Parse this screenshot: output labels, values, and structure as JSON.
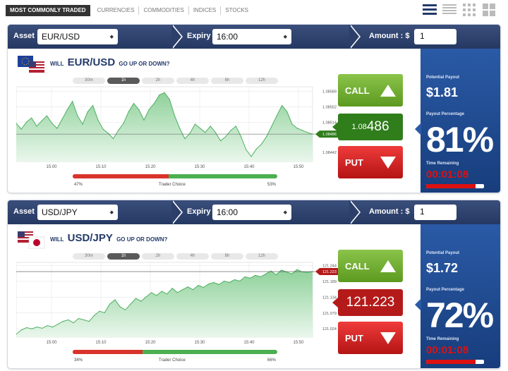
{
  "tabs": [
    {
      "label": "Most Commonly Traded",
      "active": true
    },
    {
      "label": "Currencies"
    },
    {
      "label": "Commodities"
    },
    {
      "label": "Indices"
    },
    {
      "label": "Stocks"
    }
  ],
  "labels": {
    "asset": "Asset :",
    "expiry": "Expiry :",
    "amount": "Amount : $",
    "question_prefix": "Will",
    "question_suffix": "go up or down?",
    "call": "CALL",
    "put": "PUT",
    "trader_choice": "Trader Choice",
    "potential_payout": "Potential Payout",
    "payout_percentage": "Payout Percentage",
    "time_remaining": "Time Remaining"
  },
  "timeframes": [
    "30m",
    "1h",
    "2h",
    "4h",
    "8h",
    "12h"
  ],
  "colors": {
    "navy": "#253862",
    "call_green": "#5c9a1f",
    "put_red": "#b51414",
    "side_blue": "#2a5aa6"
  },
  "panels": [
    {
      "asset": "EUR/USD",
      "expiry": "16:00",
      "amount": "1",
      "pair": "EUR/USD",
      "rate_small": "1.08",
      "rate_big": "486",
      "rate_color": "green",
      "payout": "$1.81",
      "percentage": "81%",
      "timer": "00:01:08",
      "timer_remaining_fraction": 0.85,
      "trader_call_pct": "47%",
      "trader_put_pct": "53%",
      "trader_put_fraction": 0.47,
      "active_timeframe": "1h",
      "chart_data": {
        "type": "area",
        "x_ticks": [
          "15:00",
          "15:10",
          "15:20",
          "15:30",
          "15:40",
          "15:50"
        ],
        "y_ticks": [
          "1.08589",
          "1.08552",
          "1.08514",
          "1.08486",
          "1.08442"
        ],
        "ylim": [
          1.0842,
          1.086
        ],
        "current": 1.08486,
        "values": [
          1.08512,
          1.08498,
          1.08515,
          1.08525,
          1.08505,
          1.08518,
          1.0853,
          1.08512,
          1.085,
          1.08522,
          1.08545,
          1.08565,
          1.0853,
          1.0851,
          1.0854,
          1.08555,
          1.0852,
          1.08498,
          1.08488,
          1.08475,
          1.08495,
          1.08512,
          1.0854,
          1.0856,
          1.08545,
          1.0852,
          1.08545,
          1.0856,
          1.0858,
          1.08586,
          1.0857,
          1.0853,
          1.085,
          1.08475,
          1.08488,
          1.0851,
          1.085,
          1.0849,
          1.08505,
          1.0849,
          1.0847,
          1.0848,
          1.08495,
          1.08505,
          1.0848,
          1.08448,
          1.08432,
          1.0845,
          1.08462,
          1.0848,
          1.08505,
          1.0853,
          1.08555,
          1.0854,
          1.0851,
          1.085,
          1.08495,
          1.0849,
          1.08486
        ]
      }
    },
    {
      "asset": "USD/JPY",
      "expiry": "16:00",
      "amount": "1",
      "pair": "USD/JPY",
      "rate_small": "",
      "rate_big": "121.223",
      "rate_color": "red",
      "payout": "$1.72",
      "percentage": "72%",
      "timer": "00:01:08",
      "timer_remaining_fraction": 0.85,
      "trader_call_pct": "34%",
      "trader_put_pct": "66%",
      "trader_put_fraction": 0.34,
      "active_timeframe": "1h",
      "chart_data": {
        "type": "area",
        "x_ticks": [
          "15:00",
          "15:10",
          "15:20",
          "15:30",
          "15:40",
          "15:50"
        ],
        "y_ticks": [
          "121.244",
          "121.223",
          "121.189",
          "121.134",
          "121.079",
          "121.024"
        ],
        "ylim": [
          120.995,
          121.255
        ],
        "current": 121.223,
        "values": [
          121.005,
          121.02,
          121.028,
          121.024,
          121.03,
          121.026,
          121.035,
          121.03,
          121.04,
          121.05,
          121.055,
          121.045,
          121.06,
          121.055,
          121.05,
          121.07,
          121.085,
          121.08,
          121.11,
          121.125,
          121.1,
          121.09,
          121.11,
          121.13,
          121.12,
          121.135,
          121.15,
          121.14,
          121.155,
          121.145,
          121.165,
          121.15,
          121.16,
          121.17,
          121.16,
          121.175,
          121.168,
          121.18,
          121.185,
          121.178,
          121.19,
          121.185,
          121.195,
          121.19,
          121.205,
          121.2,
          121.21,
          121.205,
          121.215,
          121.225,
          121.212,
          121.228,
          121.222,
          121.215,
          121.23,
          121.222,
          121.22,
          121.223
        ]
      }
    }
  ]
}
